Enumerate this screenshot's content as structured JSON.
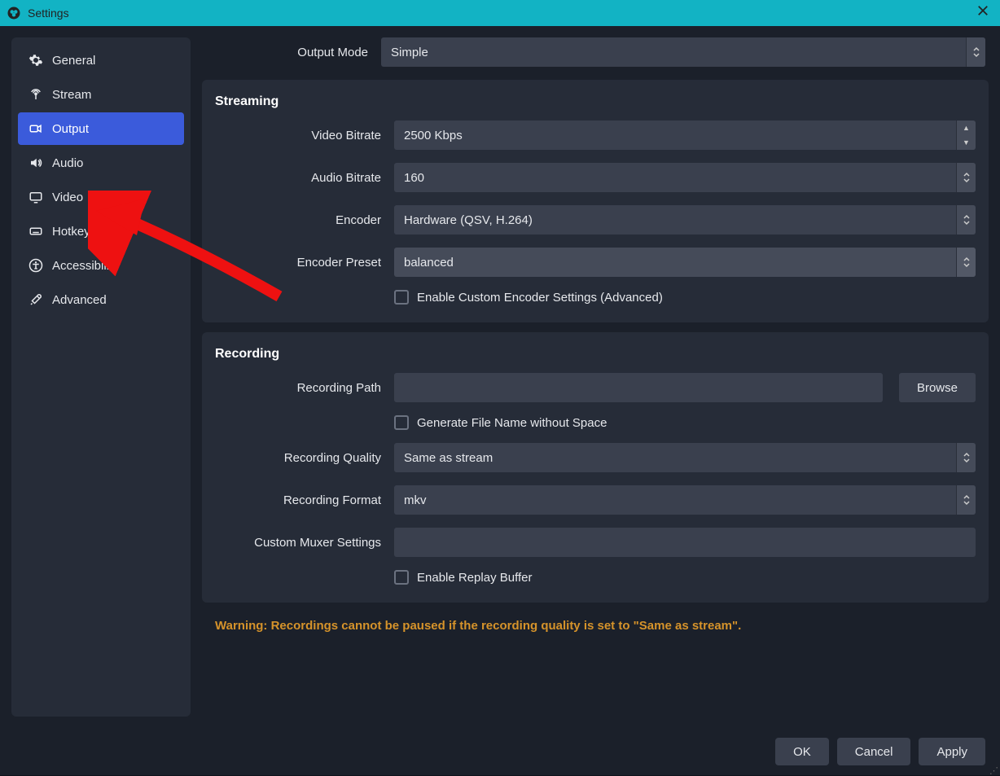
{
  "titlebar": {
    "title": "Settings"
  },
  "sidebar": {
    "items": [
      {
        "label": "General"
      },
      {
        "label": "Stream"
      },
      {
        "label": "Output"
      },
      {
        "label": "Audio"
      },
      {
        "label": "Video"
      },
      {
        "label": "Hotkeys"
      },
      {
        "label": "Accessibility"
      },
      {
        "label": "Advanced"
      }
    ]
  },
  "top": {
    "output_mode_label": "Output Mode",
    "output_mode_value": "Simple"
  },
  "streaming": {
    "title": "Streaming",
    "video_bitrate_label": "Video Bitrate",
    "video_bitrate_value": "2500 Kbps",
    "audio_bitrate_label": "Audio Bitrate",
    "audio_bitrate_value": "160",
    "encoder_label": "Encoder",
    "encoder_value": "Hardware (QSV, H.264)",
    "encoder_preset_label": "Encoder Preset",
    "encoder_preset_value": "balanced",
    "enable_custom_label": "Enable Custom Encoder Settings (Advanced)"
  },
  "recording": {
    "title": "Recording",
    "path_label": "Recording Path",
    "path_value": "",
    "browse_label": "Browse",
    "filename_nospace_label": "Generate File Name without Space",
    "quality_label": "Recording Quality",
    "quality_value": "Same as stream",
    "format_label": "Recording Format",
    "format_value": "mkv",
    "muxer_label": "Custom Muxer Settings",
    "muxer_value": "",
    "replay_buffer_label": "Enable Replay Buffer"
  },
  "warning_text": "Warning: Recordings cannot be paused if the recording quality is set to \"Same as stream\".",
  "footer": {
    "ok": "OK",
    "cancel": "Cancel",
    "apply": "Apply"
  }
}
